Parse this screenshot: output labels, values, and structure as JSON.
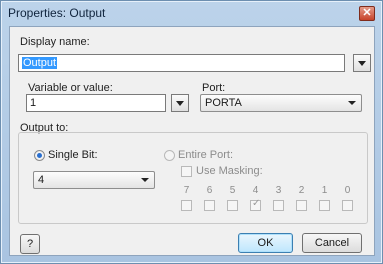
{
  "window": {
    "title": "Properties: Output"
  },
  "display_name": {
    "label": "Display name:",
    "value": "Output"
  },
  "variable": {
    "label": "Variable or value:",
    "value": "1"
  },
  "port": {
    "label": "Port:",
    "value": "PORTA"
  },
  "output_to": {
    "label": "Output to:",
    "single_bit": {
      "label": "Single Bit:",
      "selected": true,
      "value": "4"
    },
    "entire_port": {
      "label": "Entire Port:",
      "selected": false
    },
    "use_masking": {
      "label": "Use Masking:",
      "checked": false
    },
    "bits": [
      {
        "label": "7",
        "checked": false
      },
      {
        "label": "6",
        "checked": false
      },
      {
        "label": "5",
        "checked": false
      },
      {
        "label": "4",
        "checked": true
      },
      {
        "label": "3",
        "checked": false
      },
      {
        "label": "2",
        "checked": false
      },
      {
        "label": "1",
        "checked": false
      },
      {
        "label": "0",
        "checked": false
      }
    ]
  },
  "buttons": {
    "help": "?",
    "ok": "OK",
    "cancel": "Cancel"
  },
  "icons": {
    "close": "close-icon",
    "dropdown": "chevron-down-icon"
  }
}
